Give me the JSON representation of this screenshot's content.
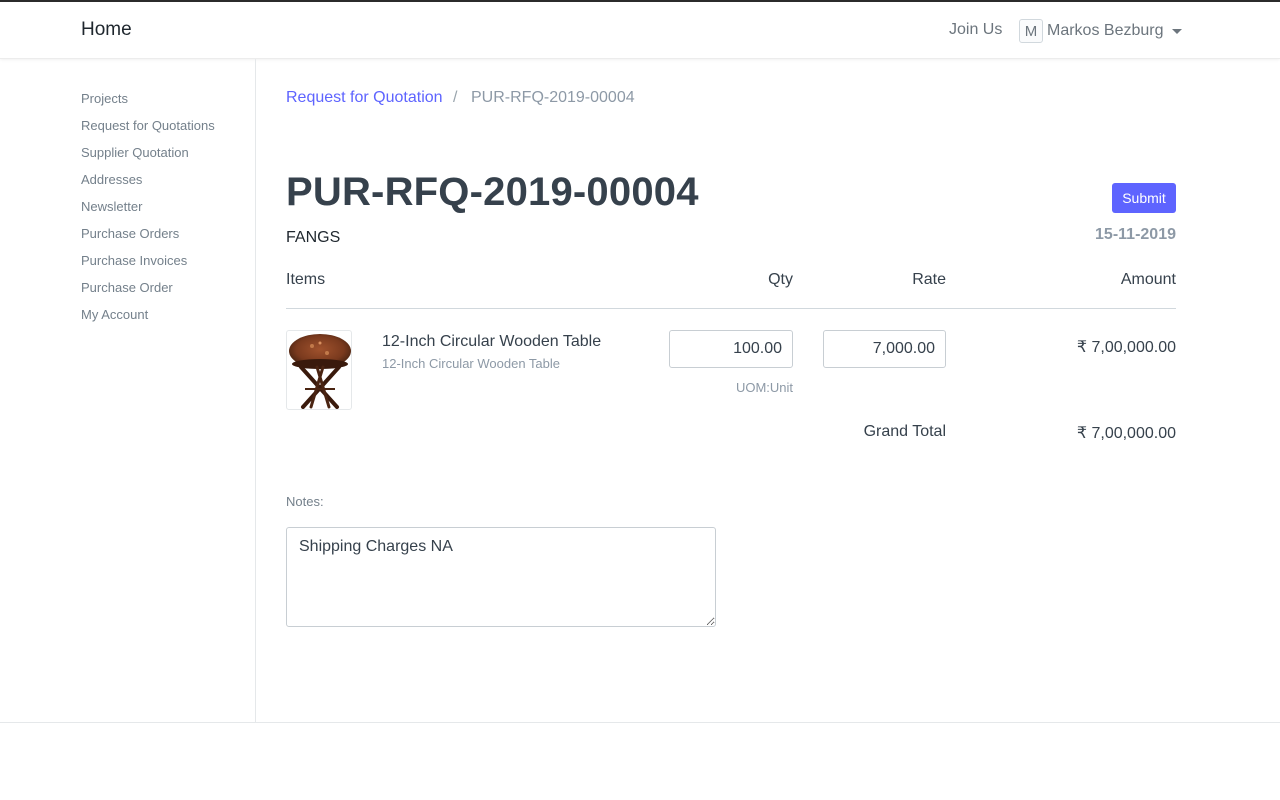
{
  "navbar": {
    "brand": "Home",
    "join_us": "Join Us",
    "user_initial": "M",
    "user_name": "Markos Bezburg"
  },
  "sidebar": {
    "items": [
      {
        "label": "Projects"
      },
      {
        "label": "Request for Quotations"
      },
      {
        "label": "Supplier Quotation"
      },
      {
        "label": "Addresses"
      },
      {
        "label": "Newsletter"
      },
      {
        "label": "Purchase Orders"
      },
      {
        "label": "Purchase Invoices"
      },
      {
        "label": "Purchase Order"
      },
      {
        "label": "My Account"
      }
    ]
  },
  "breadcrumb": {
    "parent": "Request for Quotation",
    "separator": "/",
    "current": "PUR-RFQ-2019-00004"
  },
  "document": {
    "title": "PUR-RFQ-2019-00004",
    "supplier": "FANGS",
    "date": "15-11-2019",
    "submit_label": "Submit"
  },
  "table": {
    "headers": {
      "items": "Items",
      "qty": "Qty",
      "rate": "Rate",
      "amount": "Amount"
    },
    "rows": [
      {
        "item_name": "12-Inch Circular Wooden Table",
        "description": "12-Inch Circular Wooden Table",
        "qty": "100.00",
        "rate": "7,000.00",
        "uom": "UOM:Unit",
        "amount": "₹ 7,00,000.00",
        "image_icon": "wooden-table-image"
      }
    ],
    "grand_total_label": "Grand Total",
    "grand_total": "₹ 7,00,000.00"
  },
  "notes": {
    "label": "Notes:",
    "value": "Shipping Charges NA"
  },
  "colors": {
    "accent": "#5e64ff",
    "text": "#36414c",
    "muted": "#8d99a6"
  }
}
